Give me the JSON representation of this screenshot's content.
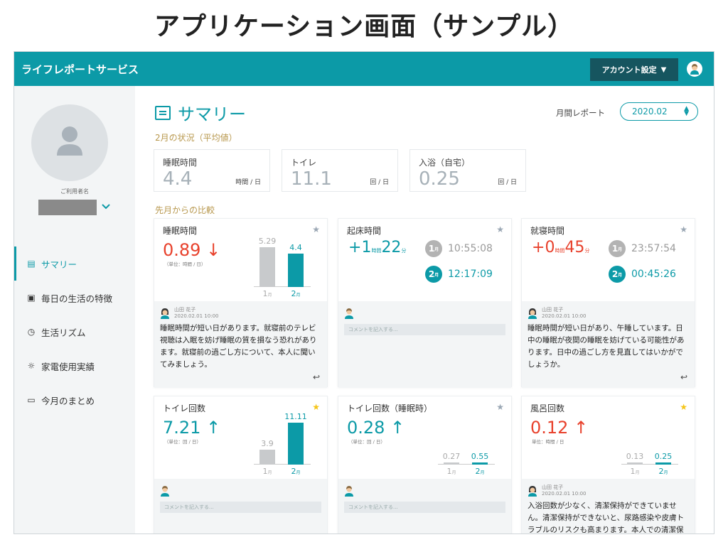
{
  "heading": "アプリケーション画面（サンプル）",
  "app": {
    "title": "ライフレポートサービス",
    "account_label": "アカウント設定",
    "account_chevron": "⌄"
  },
  "sidebar": {
    "user_label": "ご利用者名",
    "items": [
      {
        "icon": "summary-icon",
        "glyph": "▤",
        "label": "サマリー",
        "active": true
      },
      {
        "icon": "calendar-icon",
        "glyph": "▣",
        "label": "毎日の生活の特徴",
        "active": false
      },
      {
        "icon": "clock-icon",
        "glyph": "◷",
        "label": "生活リズム",
        "active": false
      },
      {
        "icon": "bulb-icon",
        "glyph": "☼",
        "label": "家電使用実績",
        "active": false
      },
      {
        "icon": "comment-icon",
        "glyph": "▭",
        "label": "今月のまとめ",
        "active": false
      }
    ]
  },
  "main": {
    "title": "サマリー",
    "report_label": "月間レポート",
    "report_value": "2020.02",
    "status_label": "2月の状況（平均値）",
    "compare_label": "先月からの比較"
  },
  "stats": [
    {
      "label": "睡眠時間",
      "value": "4.4",
      "unit": "時間 / 日"
    },
    {
      "label": "トイレ",
      "value": "11.1",
      "unit": "回 / 日"
    },
    {
      "label": "入浴（自宅）",
      "value": "0.25",
      "unit": "回 / 日"
    }
  ],
  "colors": {
    "accent": "#0c9aa7",
    "header_dark": "#16555f",
    "down_red": "#e8412c",
    "star_gray": "#9aa7b4",
    "star_yellow": "#f5c518",
    "bar_gray": "#c8cacc",
    "badge_gray": "#b3b3b3",
    "gold_label": "#b8984e"
  },
  "cards": {
    "sleep": {
      "title": "睡眠時間",
      "star": "★",
      "star_color": "gray",
      "value": "0.89",
      "arrow": "↓",
      "unit_note": "（単位：時間 / 日）",
      "chart": {
        "prev": 5.29,
        "curr": 4.4,
        "prev_label": "5.29",
        "curr_label": "4.4",
        "max": 6
      },
      "x1": "1",
      "x2": "2",
      "month_suffix": "月",
      "comment": {
        "name": "山田 花子",
        "date": "2020.02.01 10:00",
        "text": "睡眠時間が短い日があります。就寝前のテレビ視聴は入眠を妨げ睡眠の質を損なう恐れがあります。就寝前の過ごし方について、本人に聞いてみましょう。",
        "reply_icon": "↩"
      }
    },
    "wake": {
      "title": "起床時間",
      "star": "★",
      "sign": "+",
      "h": "1",
      "h_unit": "時間",
      "m": "22",
      "m_unit": "分",
      "m1_num": "1",
      "m1_time": "10:55:08",
      "m2_num": "2",
      "m2_time": "12:17:09",
      "month_suffix": "月",
      "comment_placeholder": "コメントを記入する..."
    },
    "bed": {
      "title": "就寝時間",
      "star": "★",
      "sign": "+",
      "h": "0",
      "h_unit": "時間",
      "m": "45",
      "m_unit": "分",
      "m1_num": "1",
      "m1_time": "23:57:54",
      "m2_num": "2",
      "m2_time": "00:45:26",
      "month_suffix": "月",
      "comment": {
        "name": "山田 花子",
        "date": "2020.02.01 10:00",
        "text": "睡眠時間が短い日があり、午睡しています。日中の睡眠が夜間の睡眠を妨げている可能性があります。日中の過ごし方を見直してはいかがでしょうか。",
        "reply_icon": "↩"
      }
    },
    "toilet": {
      "title": "トイレ回数",
      "star": "★",
      "value": "7.21",
      "arrow": "↑",
      "unit_note": "（単位：回 / 日）",
      "chart": {
        "prev": 3.9,
        "curr": 11.11,
        "prev_label": "3.9",
        "curr_label": "11.11",
        "max": 12
      },
      "x1": "1",
      "x2": "2",
      "month_suffix": "月",
      "comment_placeholder": "コメントを記入する..."
    },
    "toilet_night": {
      "title": "トイレ回数（睡眠時）",
      "star": "★",
      "value": "0.28",
      "arrow": "↑",
      "unit_note": "（単位：回 / 日）",
      "chart": {
        "prev": 0.27,
        "curr": 0.55,
        "prev_label": "0.27",
        "curr_label": "0.55",
        "max": 12
      },
      "x1": "1",
      "x2": "2",
      "month_suffix": "月",
      "comment_placeholder": "コメントを記入する..."
    },
    "bath": {
      "title": "風呂回数",
      "star": "★",
      "value": "0.12",
      "arrow": "↑",
      "unit_note": "単位：時間 / 日",
      "chart": {
        "prev": 0.13,
        "curr": 0.25,
        "prev_label": "0.13",
        "curr_label": "0.25",
        "max": 12
      },
      "x1": "1",
      "x2": "2",
      "month_suffix": "月",
      "comment": {
        "name": "山田 花子",
        "date": "2020.02.01 10:00",
        "text": "入浴回数が少なく、清潔保持ができていません。清潔保持ができないと、尿路感染や皮膚トラブルのリスクも高まります。本人での清潔保"
      }
    }
  }
}
